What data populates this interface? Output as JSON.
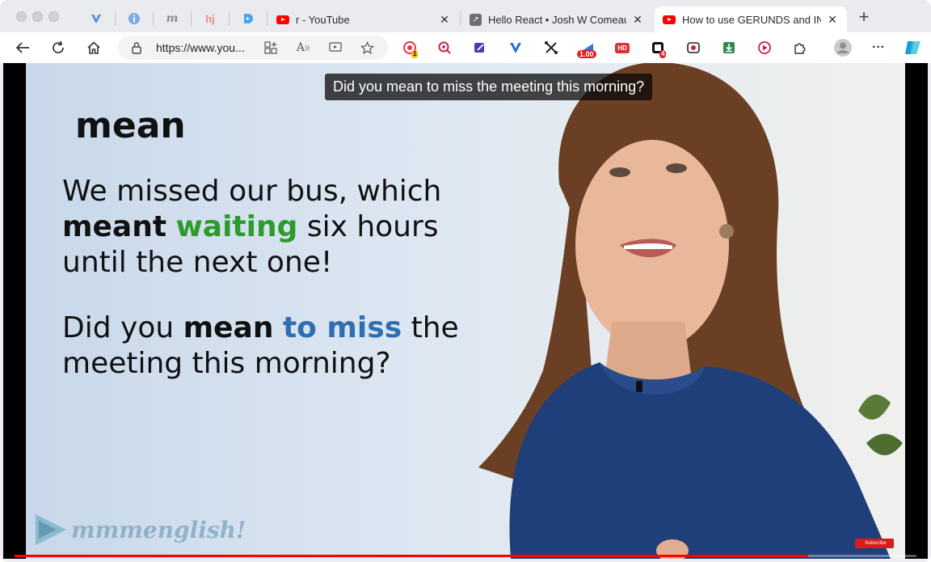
{
  "tabs": {
    "pinned": [
      {
        "name": "pinned-tab-v-icon",
        "glyph": "Y",
        "color": "#3d7de0"
      },
      {
        "name": "pinned-tab-info-icon",
        "glyph": "i",
        "color": "#6b9be8"
      },
      {
        "name": "pinned-tab-m-icon",
        "glyph": "m",
        "color": "#8a8a8a"
      },
      {
        "name": "pinned-tab-hj-icon",
        "glyph": "hj",
        "color": "#f08a80"
      },
      {
        "name": "pinned-tab-d-icon",
        "glyph": "D",
        "color": "#4aa3f0"
      }
    ],
    "open": [
      {
        "title": "r - YouTube",
        "favicon": "youtube-icon"
      },
      {
        "title": "Hello React • Josh W Comeau's",
        "favicon": "external-link-icon"
      },
      {
        "title": "How to use GERUNDS and INFINIT",
        "favicon": "youtube-icon",
        "active": true
      }
    ]
  },
  "toolbar": {
    "url": "https://www.you...",
    "extensions": [
      {
        "name": "record-extension-icon",
        "badge": "1"
      },
      {
        "name": "zoom-search-extension-icon"
      },
      {
        "name": "edit-extension-icon"
      },
      {
        "name": "vee-extension-icon"
      },
      {
        "name": "cross-tools-extension-icon"
      },
      {
        "name": "speed-extension-icon",
        "badge": "1.00"
      },
      {
        "name": "hd-extension-icon",
        "label": "HD"
      },
      {
        "name": "counter-extension-icon",
        "badge": "4"
      },
      {
        "name": "screen-record-extension-icon"
      },
      {
        "name": "download-extension-icon"
      },
      {
        "name": "play-extension-icon"
      },
      {
        "name": "puzzle-extensions-icon"
      }
    ]
  },
  "video": {
    "caption": "Did you mean to miss the meeting this morning?",
    "headword": "mean",
    "sentence1": {
      "line1": "We missed our bus, which",
      "line2_bold": "meant",
      "line2_green": "waiting",
      "line2_rest": "six hours",
      "line3": "until the next one!"
    },
    "sentence2": {
      "line1_start": "Did you",
      "line1_bold": "mean",
      "line1_blue": "to miss",
      "line1_end": "the",
      "line2": "meeting this morning?"
    },
    "logo": "mmmenglish!",
    "subscribe": "Subscribe",
    "progress": 0.88
  }
}
